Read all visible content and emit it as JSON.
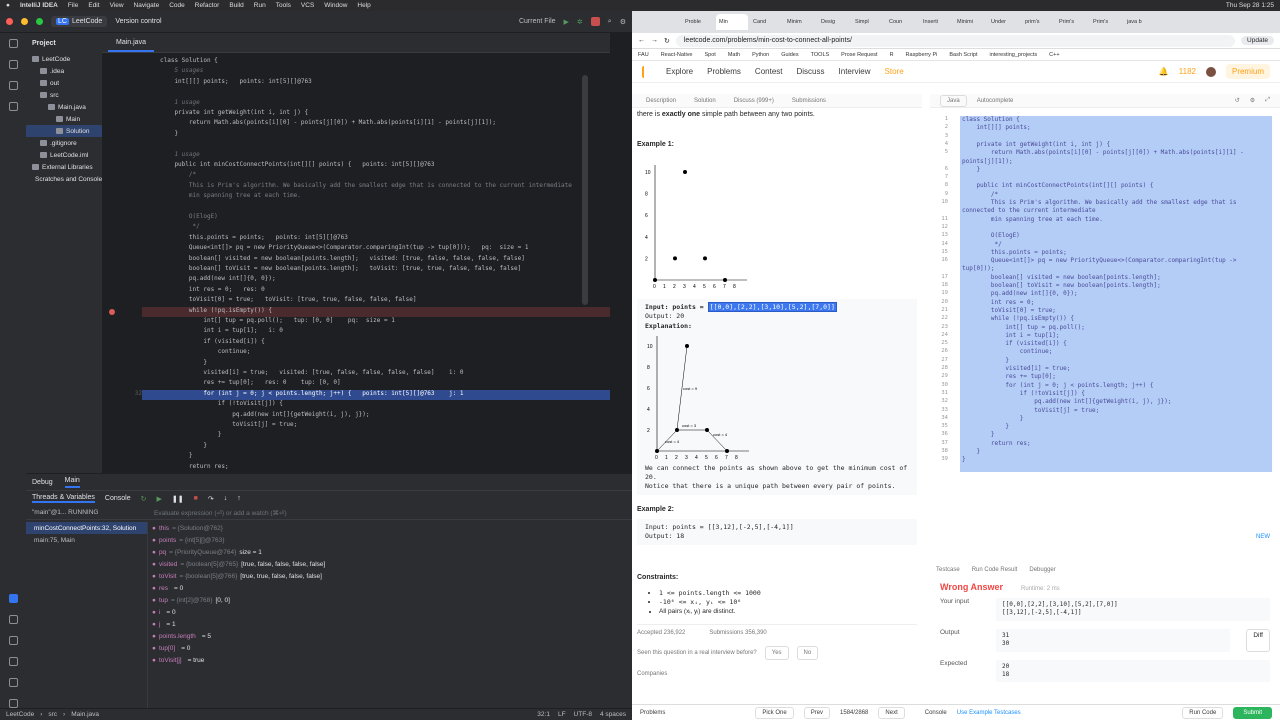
{
  "macbar": {
    "app": "IntelliJ IDEA",
    "menus": [
      "File",
      "Edit",
      "View",
      "Navigate",
      "Code",
      "Refactor",
      "Build",
      "Run",
      "Tools",
      "VCS",
      "Window",
      "Help"
    ],
    "clock": "Thu Sep 28  1:25"
  },
  "ide": {
    "project_badge": "LC",
    "project_name": "LeetCode",
    "vcs": "Version control",
    "run_config": "Current File",
    "project_label": "Project",
    "tree": [
      {
        "label": "LeetCode",
        "sub": "~/Lc",
        "indent": 6,
        "sel": false
      },
      {
        "label": ".idea",
        "indent": 14,
        "sel": false
      },
      {
        "label": "out",
        "indent": 14,
        "sel": false
      },
      {
        "label": "src",
        "indent": 14,
        "sel": false
      },
      {
        "label": "Main.java",
        "indent": 22,
        "sel": false
      },
      {
        "label": "Main",
        "indent": 30,
        "sel": false
      },
      {
        "label": "Solution",
        "indent": 30,
        "sel": true
      },
      {
        "label": ".gitignore",
        "indent": 14,
        "sel": false
      },
      {
        "label": "LeetCode.iml",
        "indent": 14,
        "sel": false
      },
      {
        "label": "External Libraries",
        "indent": 6,
        "sel": false
      },
      {
        "label": "Scratches and Consoles",
        "indent": 6,
        "sel": false
      }
    ],
    "tab": "Main.java",
    "code": [
      {
        "n": "",
        "t": "class Solution {",
        "cls": ""
      },
      {
        "n": "",
        "t": "    5 usages",
        "cls": "hint"
      },
      {
        "n": "",
        "t": "    int[][] points;   points: int[5][]@763",
        "cls": ""
      },
      {
        "n": "",
        "t": "",
        "cls": ""
      },
      {
        "n": "",
        "t": "    1 usage",
        "cls": "hint"
      },
      {
        "n": "",
        "t": "    private int getWeight(int i, int j) {",
        "cls": ""
      },
      {
        "n": "",
        "t": "        return Math.abs(points[i][0] - points[j][0]) + Math.abs(points[i][1] - points[j][1]);",
        "cls": ""
      },
      {
        "n": "",
        "t": "    }",
        "cls": ""
      },
      {
        "n": "",
        "t": "",
        "cls": ""
      },
      {
        "n": "",
        "t": "    1 usage",
        "cls": "hint"
      },
      {
        "n": "",
        "t": "    public int minCostConnectPoints(int[][] points) {   points: int[5][]@763",
        "cls": ""
      },
      {
        "n": "",
        "t": "        /*",
        "cls": "cm"
      },
      {
        "n": "",
        "t": "        This is Prim's algorithm. We basically add the smallest edge that is connected to the current intermediate",
        "cls": "cm"
      },
      {
        "n": "",
        "t": "        min spanning tree at each time.",
        "cls": "cm"
      },
      {
        "n": "",
        "t": "",
        "cls": ""
      },
      {
        "n": "",
        "t": "        O(ElogE)",
        "cls": "cm"
      },
      {
        "n": "",
        "t": "         */",
        "cls": "cm"
      },
      {
        "n": "",
        "t": "        this.points = points;   points: int[5][]@763",
        "cls": ""
      },
      {
        "n": "",
        "t": "        Queue<int[]> pq = new PriorityQueue<>(Comparator.comparingInt(tup -> tup[0]));   pq:  size = 1",
        "cls": ""
      },
      {
        "n": "",
        "t": "        boolean[] visited = new boolean[points.length];   visited: [true, false, false, false, false]",
        "cls": ""
      },
      {
        "n": "",
        "t": "        boolean[] toVisit = new boolean[points.length];   toVisit: [true, true, false, false, false]",
        "cls": ""
      },
      {
        "n": "",
        "t": "        pq.add(new int[]{0, 0});",
        "cls": ""
      },
      {
        "n": "",
        "t": "        int res = 0;   res: 0",
        "cls": ""
      },
      {
        "n": "",
        "t": "        toVisit[0] = true;   toVisit: [true, true, false, false, false]",
        "cls": ""
      },
      {
        "n": "",
        "t": "        while (!pq.isEmpty()) {",
        "cls": "bp"
      },
      {
        "n": "",
        "t": "            int[] tup = pq.poll();   tup: [0, 0]    pq:  size = 1",
        "cls": ""
      },
      {
        "n": "",
        "t": "            int i = tup[1];   i: 0",
        "cls": ""
      },
      {
        "n": "",
        "t": "            if (visited[i]) {",
        "cls": ""
      },
      {
        "n": "",
        "t": "                continue;",
        "cls": ""
      },
      {
        "n": "",
        "t": "            }",
        "cls": ""
      },
      {
        "n": "",
        "t": "            visited[i] = true;   visited: [true, false, false, false, false]    i: 0",
        "cls": ""
      },
      {
        "n": "",
        "t": "            res += tup[0];   res: 0    tup: [0, 0]",
        "cls": ""
      },
      {
        "n": "32",
        "t": "            for (int j = 0; j < points.length; j++) {   points: int[5][]@763    j: 1",
        "cls": "cur"
      },
      {
        "n": "",
        "t": "                if (!toVisit[j]) {",
        "cls": ""
      },
      {
        "n": "",
        "t": "                    pq.add(new int[]{getWeight(i, j), j});",
        "cls": ""
      },
      {
        "n": "",
        "t": "                    toVisit[j] = true;",
        "cls": ""
      },
      {
        "n": "",
        "t": "                }",
        "cls": ""
      },
      {
        "n": "",
        "t": "            }",
        "cls": ""
      },
      {
        "n": "",
        "t": "        }",
        "cls": ""
      },
      {
        "n": "",
        "t": "        return res;",
        "cls": ""
      },
      {
        "n": "",
        "t": "    }",
        "cls": ""
      },
      {
        "n": "",
        "t": "}",
        "cls": ""
      }
    ],
    "debug": {
      "tab_debug": "Debug",
      "tab_main": "Main",
      "tab_threads": "Threads & Variables",
      "tab_console": "Console",
      "thread": "\"main\"@1... RUNNING",
      "eval_placeholder": "Evaluate expression (⏎) or add a watch (⌘⏎)",
      "frames": [
        {
          "t": "minCostConnectPoints:32, Solution",
          "sel": true
        },
        {
          "t": "main:75, Main",
          "sel": false
        }
      ],
      "vars": [
        {
          "name": "this",
          "type": "= {Solution@762}",
          "val": ""
        },
        {
          "name": "points",
          "type": "= {int[5][]@763}",
          "val": ""
        },
        {
          "name": "pq",
          "type": "= {PriorityQueue@764}",
          "val": "size = 1"
        },
        {
          "name": "visited",
          "type": "= {boolean[5]@765}",
          "val": "[true, false, false, false, false]"
        },
        {
          "name": "toVisit",
          "type": "= {boolean[5]@766}",
          "val": "[true, true, false, false, false]"
        },
        {
          "name": "res",
          "type": "",
          "val": "= 0"
        },
        {
          "name": "tup",
          "type": "= {int[2]@768}",
          "val": "[0, 0]"
        },
        {
          "name": "i",
          "type": "",
          "val": "= 0"
        },
        {
          "name": "j",
          "type": "",
          "val": "= 1"
        },
        {
          "name": "points.length",
          "type": "",
          "val": "= 5"
        },
        {
          "name": "tup[0]",
          "type": "",
          "val": "= 0"
        },
        {
          "name": "toVisit[j]",
          "type": "",
          "val": "= true"
        }
      ]
    },
    "status": {
      "crumbs": [
        "LeetCode",
        "src",
        "Main.java"
      ],
      "pos": "32:1",
      "lf": "LF",
      "enc": "UTF-8",
      "indent": "4 spaces"
    }
  },
  "browser": {
    "tabs": [
      "Proble",
      "Min",
      "Cand",
      "Minim",
      "Desig",
      "Simpl",
      "Coun",
      "Inserti",
      "Minimi",
      "Under",
      "prim's",
      "Prim's",
      "Prim's",
      "java b"
    ],
    "url": "leetcode.com/problems/min-cost-to-connect-all-points/",
    "update": "Update",
    "bookmarks": [
      "FAU",
      "React-Native",
      "Spot",
      "Math",
      "Python",
      "Guides",
      "TOOLS",
      "Prose Request",
      "R",
      "Raspberry Pi",
      "Bash Script",
      "interesting_projects",
      "C++"
    ],
    "nav": {
      "explore": "Explore",
      "problems": "Problems",
      "contest": "Contest",
      "discuss": "Discuss",
      "interview": "Interview",
      "store": "Store",
      "coins": "1182",
      "premium": "Premium"
    },
    "ltabs": [
      "Description",
      "Solution",
      "Discuss (999+)",
      "Submissions"
    ],
    "intro_pre": "there is ",
    "intro_b": "exactly one",
    "intro_post": " simple path between any two points.",
    "ex1": "Example 1:",
    "input_pre": "Input: points = ",
    "input_sel": "[[0,0],[2,2],[3,10],[5,2],[7,0]]",
    "output": "Output: 20",
    "expl": "Explanation:",
    "expl_text": "We can connect the points as shown above to get the minimum cost of 20.",
    "expl_text2": "Notice that there is a unique path between every pair of points.",
    "ex2": "Example 2:",
    "ex2_input": "Input: points = [[3,12],[-2,5],[-4,1]]",
    "ex2_output": "Output: 18",
    "constraints": "Constraints:",
    "c1": "1 <= points.length <= 1000",
    "c2": "-10⁶ <= xᵢ, yᵢ <= 10⁶",
    "c3": "All pairs (xᵢ, yᵢ) are distinct.",
    "accepted": "Accepted  236,922",
    "submissions": "Submissions  356,390",
    "seen": "Seen this question in a real interview before?",
    "yes": "Yes",
    "no": "No",
    "companies": "Companies",
    "lang": "Java",
    "autocomplete": "Autocomplete",
    "new": "NEW",
    "plot1": {
      "x": [
        0,
        2,
        3,
        5,
        7
      ],
      "y": [
        0,
        2,
        10,
        2,
        0
      ],
      "ticks_x": [
        "0",
        "1",
        "2",
        "3",
        "4",
        "5",
        "6",
        "7",
        "8"
      ],
      "ticks_y": [
        "2",
        "4",
        "6",
        "8",
        "10"
      ]
    },
    "plot2": {
      "costs": [
        "cost = 9",
        "cost = 3",
        "cost = 4",
        "cost = 4"
      ]
    },
    "code": [
      "class Solution {",
      "    int[][] points;",
      "",
      "    private int getWeight(int i, int j) {",
      "        return Math.abs(points[i][0] - points[j][0]) + Math.abs(points[i][1] -",
      "points[j][1]);",
      "    }",
      "",
      "    public int minCostConnectPoints(int[][] points) {",
      "        /*",
      "        This is Prim's algorithm. We basically add the smallest edge that is",
      "connected to the current intermediate",
      "        min spanning tree at each time.",
      "",
      "        O(ElogE)",
      "         */",
      "        this.points = points;",
      "        Queue<int[]> pq = new PriorityQueue<>(Comparator.comparingInt(tup ->",
      "tup[0]));",
      "        boolean[] visited = new boolean[points.length];",
      "        boolean[] toVisit = new boolean[points.length];",
      "        pq.add(new int[]{0, 0});",
      "        int res = 0;",
      "        toVisit[0] = true;",
      "        while (!pq.isEmpty()) {",
      "            int[] tup = pq.poll();",
      "            int i = tup[1];",
      "            if (visited[i]) {",
      "                continue;",
      "            }",
      "            visited[i] = true;",
      "            res += tup[0];",
      "            for (int j = 0; j < points.length; j++) {",
      "                if (!toVisit[j]) {",
      "                    pq.add(new int[]{getWeight(i, j), j});",
      "                    toVisit[j] = true;",
      "                }",
      "            }",
      "        }",
      "        return res;",
      "    }",
      "}"
    ],
    "code_nums": [
      "1",
      "2",
      "3",
      "4",
      "5",
      "",
      "6",
      "7",
      "8",
      "9",
      "10",
      "",
      "11",
      "12",
      "13",
      "14",
      "15",
      "16",
      "",
      "17",
      "18",
      "19",
      "20",
      "21",
      "22",
      "23",
      "24",
      "25",
      "26",
      "27",
      "28",
      "29",
      "30",
      "31",
      "32",
      "33",
      "34",
      "35",
      "36",
      "37",
      "38",
      "39",
      "40"
    ],
    "test": {
      "tabs": [
        "Testcase",
        "Run Code Result",
        "Debugger"
      ],
      "status": "Wrong Answer",
      "runtime": "Runtime: 2 ms",
      "your_input_lab": "Your input",
      "your_input": [
        "[[0,0],[2,2],[3,10],[5,2],[7,0]]",
        "[[3,12],[-2,5],[-4,1]]"
      ],
      "output_lab": "Output",
      "output": [
        "31",
        "30"
      ],
      "expected_lab": "Expected",
      "expected": [
        "20",
        "18"
      ],
      "diff": "Diff"
    },
    "bottom": {
      "problems": "Problems",
      "pick": "Pick One",
      "prev": "Prev",
      "page": "1584/2868",
      "next": "Next",
      "console": "Console",
      "use": "Use Example Testcases",
      "run": "Run Code",
      "submit": "Submit"
    }
  }
}
